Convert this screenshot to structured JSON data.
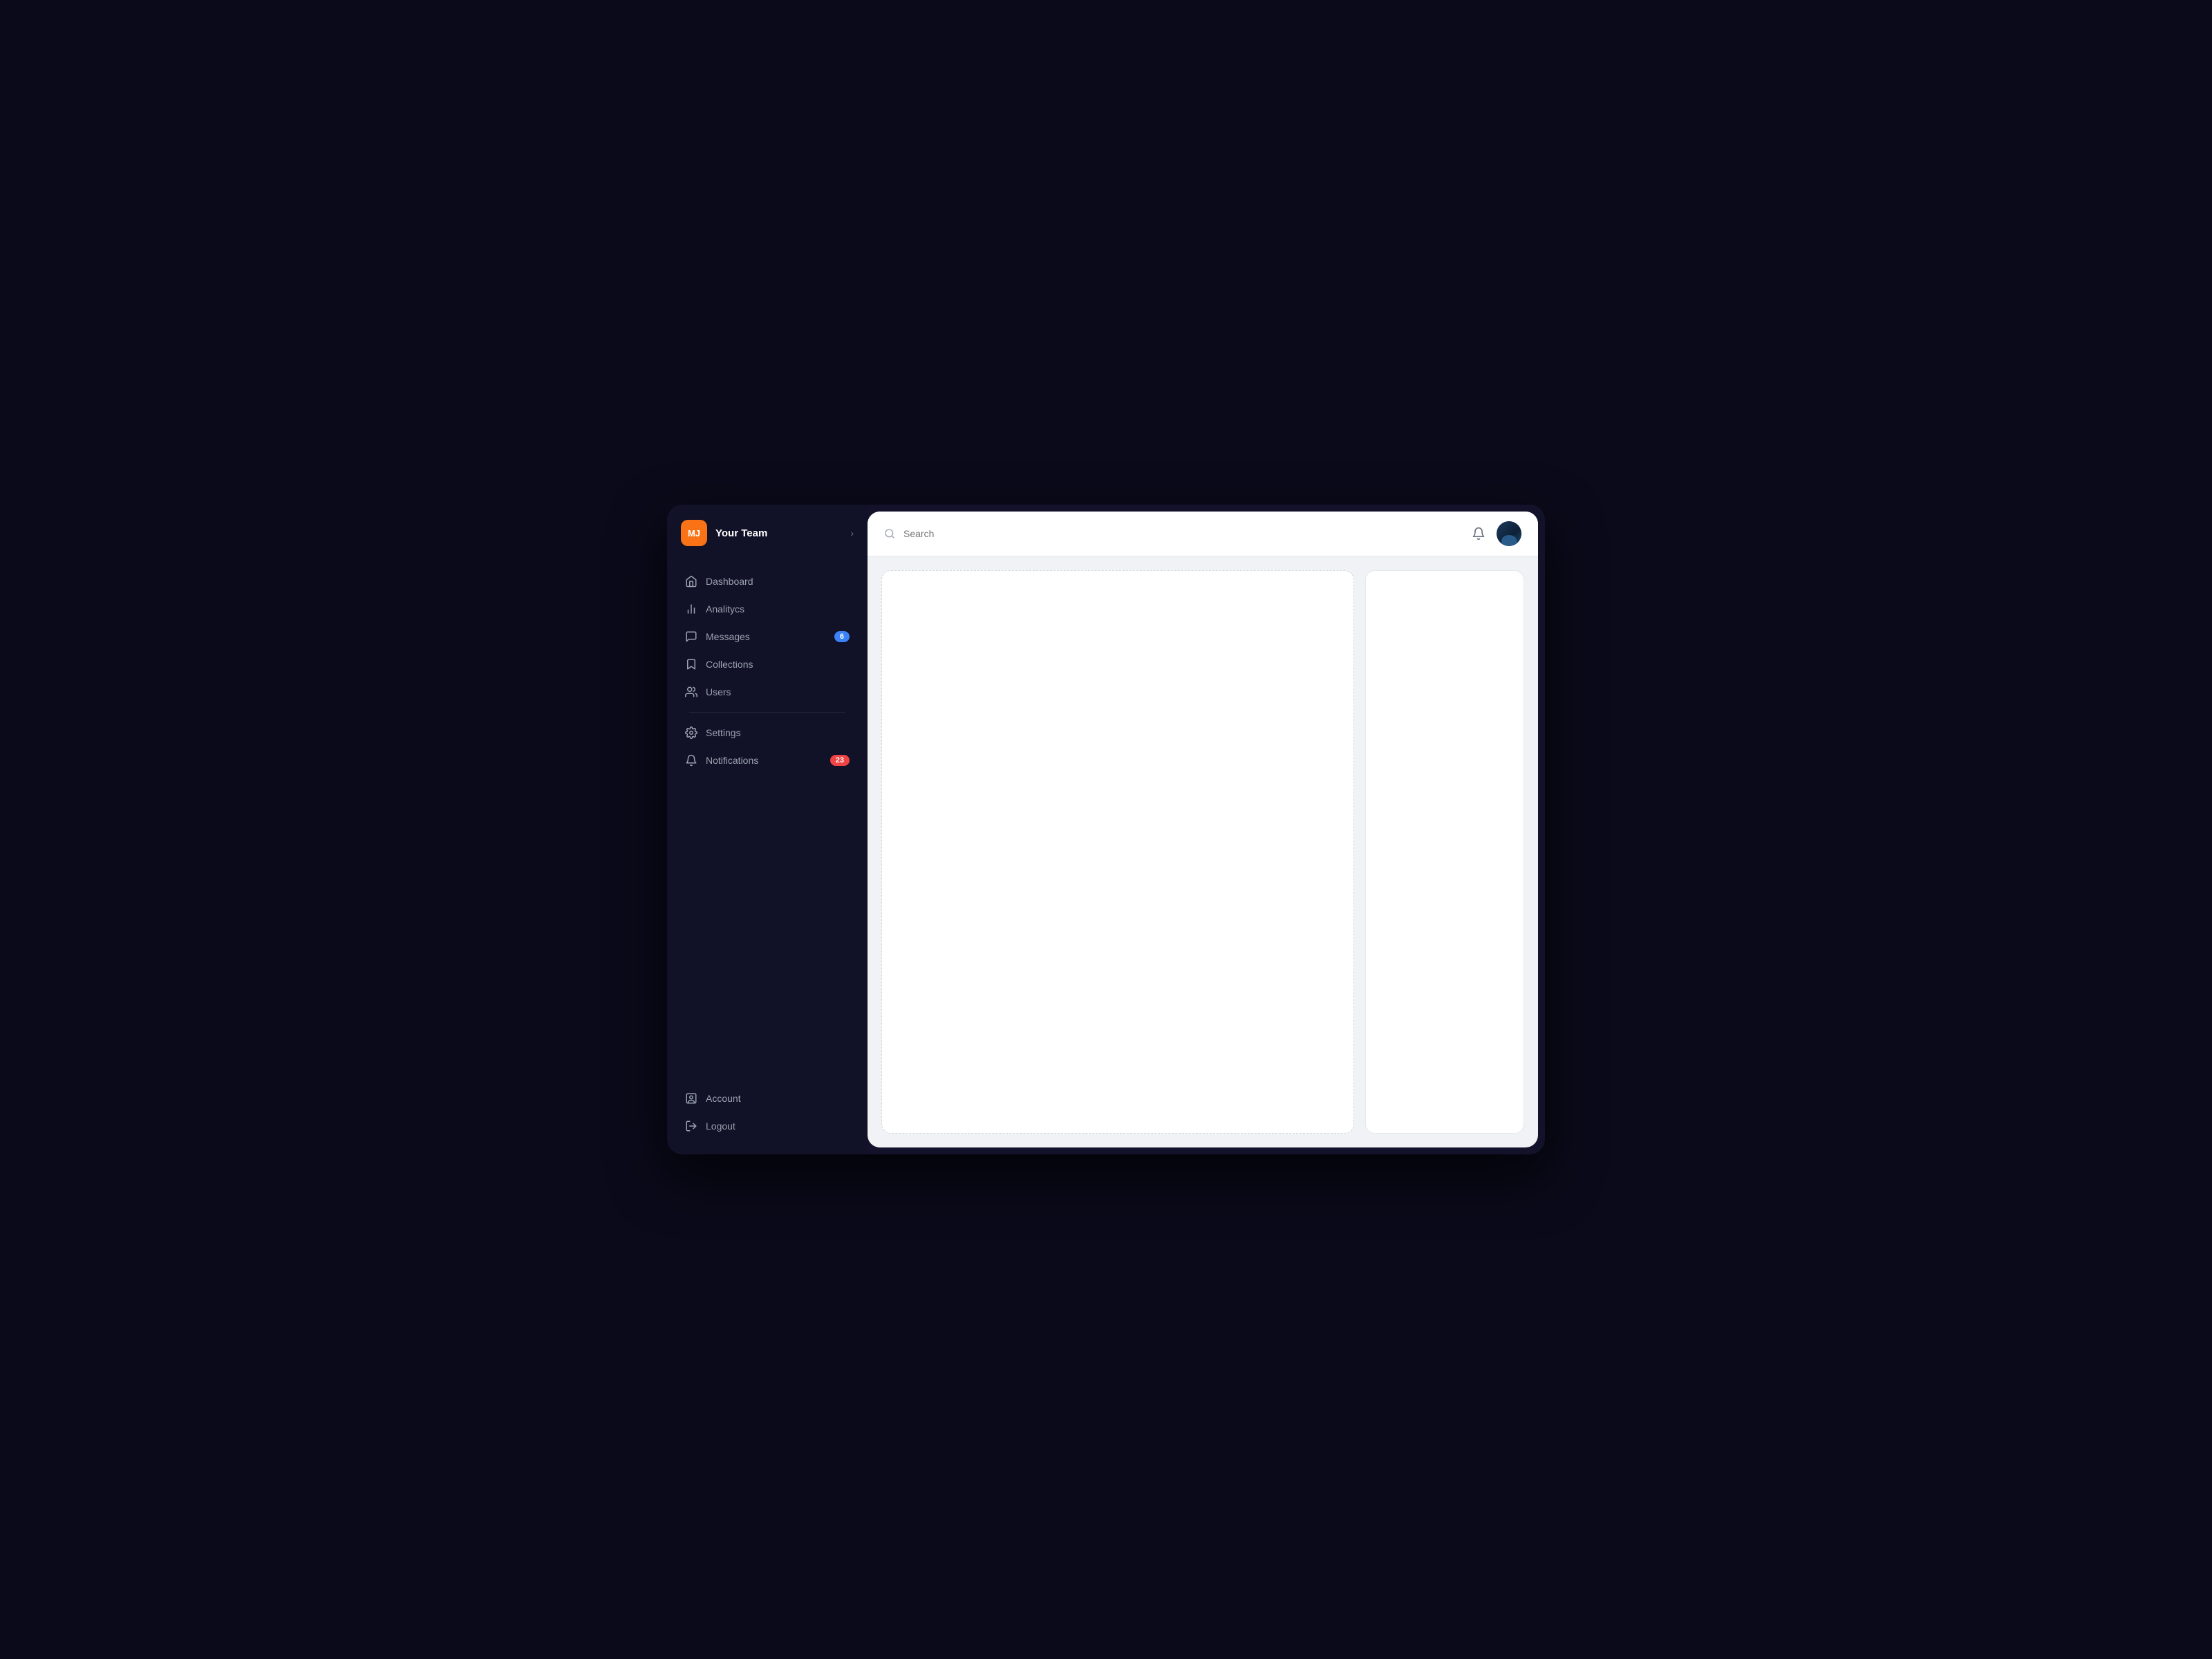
{
  "sidebar": {
    "team": {
      "initials": "MJ",
      "name": "Your Team"
    },
    "nav_items": [
      {
        "id": "dashboard",
        "label": "Dashboard",
        "icon": "home",
        "badge": null
      },
      {
        "id": "analytics",
        "label": "Analitycs",
        "icon": "bar-chart",
        "badge": null
      },
      {
        "id": "messages",
        "label": "Messages",
        "icon": "message-circle",
        "badge": "6",
        "badge_color": "blue"
      },
      {
        "id": "collections",
        "label": "Collections",
        "icon": "bookmark",
        "badge": null
      },
      {
        "id": "users",
        "label": "Users",
        "icon": "users",
        "badge": null
      }
    ],
    "settings_items": [
      {
        "id": "settings",
        "label": "Settings",
        "icon": "settings",
        "badge": null
      },
      {
        "id": "notifications",
        "label": "Notifications",
        "icon": "bell",
        "badge": "23",
        "badge_color": "red"
      }
    ],
    "bottom_items": [
      {
        "id": "account",
        "label": "Account",
        "icon": "user-square"
      },
      {
        "id": "logout",
        "label": "Logout",
        "icon": "log-out"
      }
    ]
  },
  "topbar": {
    "search_placeholder": "Search",
    "bell_label": "Notifications"
  }
}
